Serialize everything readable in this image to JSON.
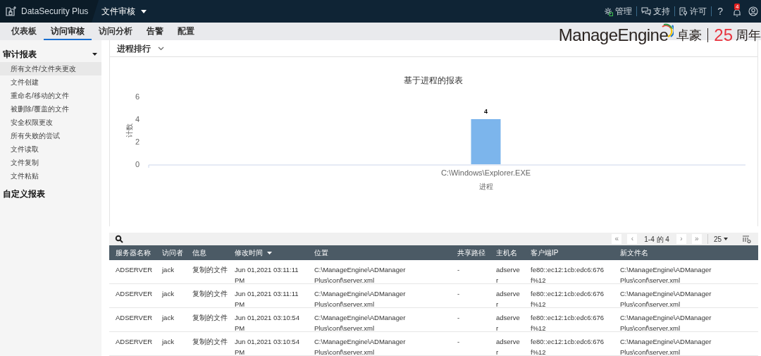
{
  "header": {
    "product": "DataSecurity Plus",
    "module": "文件审核",
    "links": [
      {
        "kind": "admin",
        "label": "管理"
      },
      {
        "kind": "support",
        "label": "支持"
      },
      {
        "kind": "license",
        "label": "许可"
      },
      {
        "kind": "help",
        "label": "?"
      }
    ],
    "notification_count": "4"
  },
  "tabs": [
    {
      "label": "仪表板",
      "selected": false
    },
    {
      "label": "访问审核",
      "selected": true
    },
    {
      "label": "访问分析",
      "selected": false
    },
    {
      "label": "告警",
      "selected": false
    },
    {
      "label": "配置",
      "selected": false
    }
  ],
  "brand": {
    "name": "ManageEngine",
    "cn_name": "卓豪",
    "anniversary_number": "25",
    "anniversary_text": "周年"
  },
  "sidebar": [
    {
      "title": "审计报表",
      "expanded": true,
      "items": [
        {
          "label": "所有文件/文件夹更改",
          "selected": true
        },
        {
          "label": "文件创建",
          "selected": false
        },
        {
          "label": "重命名/移动的文件",
          "selected": false
        },
        {
          "label": "被删除/覆盖的文件",
          "selected": false
        },
        {
          "label": "安全权限更改",
          "selected": false
        },
        {
          "label": "所有失败的尝试",
          "selected": false
        },
        {
          "label": "文件读取",
          "selected": false
        },
        {
          "label": "文件复制",
          "selected": false
        },
        {
          "label": "文件粘贴",
          "selected": false
        }
      ]
    },
    {
      "title": "自定义报表",
      "expanded": false
    }
  ],
  "section_title": "进程排行",
  "chart_data": {
    "type": "bar",
    "title": "基于进程的报表",
    "xlabel": "进程",
    "ylabel": "计数",
    "categories": [
      "C:\\Windows\\Explorer.EXE"
    ],
    "values": [
      4
    ],
    "ylim": [
      0,
      6
    ],
    "yticks": [
      0,
      2,
      4,
      6
    ],
    "data_labels": true
  },
  "pagination": {
    "first": "«",
    "prev": "‹",
    "range": "1-4 的 4",
    "next": "›",
    "last": "»",
    "page_size": "25"
  },
  "table": {
    "columns": [
      {
        "label": "服务器名称",
        "sorted": false
      },
      {
        "label": "访问者",
        "sorted": false
      },
      {
        "label": "信息",
        "sorted": false
      },
      {
        "label": "修改时间",
        "sorted": true
      },
      {
        "label": "位置",
        "sorted": false
      },
      {
        "label": "共享路径",
        "sorted": false
      },
      {
        "label": "主机名",
        "sorted": false
      },
      {
        "label": "客户端IP",
        "sorted": false
      },
      {
        "label": "新文件名",
        "sorted": false
      }
    ],
    "rows": [
      [
        "ADSERVER",
        "jack",
        "复制的文件",
        "Jun 01,2021 03:11:11 PM",
        "C:\\ManageEngine\\ADManager Plus\\conf\\server.xml",
        "-",
        "adserver",
        "fe80::ec12:1cb:edc6:676f%12",
        "C:\\ManageEngine\\ADManager Plus\\conf\\server.xml"
      ],
      [
        "ADSERVER",
        "jack",
        "复制的文件",
        "Jun 01,2021 03:11:11 PM",
        "C:\\ManageEngine\\ADManager Plus\\conf\\server.xml",
        "-",
        "adserver",
        "fe80::ec12:1cb:edc6:676f%12",
        "C:\\ManageEngine\\ADManager Plus\\conf\\server.xml"
      ],
      [
        "ADSERVER",
        "jack",
        "复制的文件",
        "Jun 01,2021 03:10:54 PM",
        "C:\\ManageEngine\\ADManager Plus\\conf\\server.xml",
        "-",
        "adserver",
        "fe80::ec12:1cb:edc6:676f%12",
        "C:\\ManageEngine\\ADManager Plus\\conf\\server.xml"
      ],
      [
        "ADSERVER",
        "jack",
        "复制的文件",
        "Jun 01,2021 03:10:54 PM",
        "C:\\ManageEngine\\ADManager Plus\\conf\\server.xml",
        "-",
        "adserver",
        "fe80::ec12:1cb:edc6:676f%12",
        "C:\\ManageEngine\\ADManager Plus\\conf\\server.xml"
      ]
    ]
  }
}
